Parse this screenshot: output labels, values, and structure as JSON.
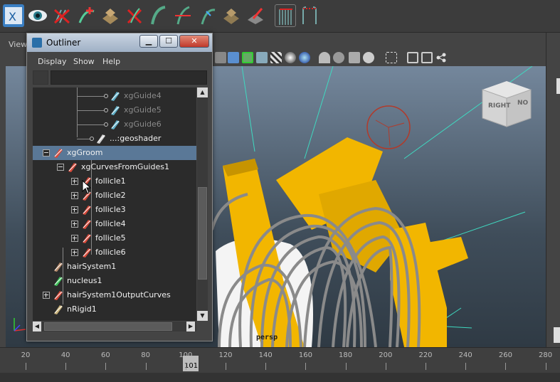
{
  "viewport_menu": {
    "view_label": "View"
  },
  "viewcube": {
    "front": "RIGHT",
    "side": "NO"
  },
  "camera_label": "persp",
  "timeline": {
    "ticks": [
      "20",
      "40",
      "60",
      "80",
      "100",
      "120",
      "140",
      "160",
      "180",
      "200",
      "220",
      "240",
      "260",
      "280"
    ],
    "current_frame": "101"
  },
  "outliner": {
    "title": "Outliner",
    "buttons": {
      "minimize": "▁",
      "maximize": "☐",
      "close": "✕"
    },
    "menu": [
      "Display",
      "Show",
      "Help"
    ],
    "search": {
      "value": ""
    },
    "rows": [
      {
        "label": "xgGuide4",
        "dim": true,
        "icon": "xgen-guide-icon"
      },
      {
        "label": "xgGuide5",
        "dim": true,
        "icon": "xgen-guide-icon"
      },
      {
        "label": "xgGuide6",
        "dim": true,
        "icon": "xgen-guide-icon"
      },
      {
        "label": "...:geoshader",
        "dim": false,
        "icon": "geoshader-icon"
      },
      {
        "label": "xgGroom",
        "dim": false,
        "icon": "groom-icon",
        "selected": true
      },
      {
        "label": "xgCurvesFromGuides1",
        "dim": false,
        "icon": "curves-icon"
      },
      {
        "label": "follicle1",
        "dim": false,
        "icon": "follicle-icon"
      },
      {
        "label": "follicle2",
        "dim": false,
        "icon": "follicle-icon"
      },
      {
        "label": "follicle3",
        "dim": false,
        "icon": "follicle-icon"
      },
      {
        "label": "follicle4",
        "dim": false,
        "icon": "follicle-icon"
      },
      {
        "label": "follicle5",
        "dim": false,
        "icon": "follicle-icon"
      },
      {
        "label": "follicle6",
        "dim": false,
        "icon": "follicle-icon"
      },
      {
        "label": "hairSystem1",
        "dim": false,
        "icon": "hair-system-icon"
      },
      {
        "label": "nucleus1",
        "dim": false,
        "icon": "nucleus-icon"
      },
      {
        "label": "hairSystem1OutputCurves",
        "dim": false,
        "icon": "output-curves-icon"
      },
      {
        "label": "nRigid1",
        "dim": false,
        "icon": "nrigid-icon"
      }
    ]
  },
  "colors": {
    "yellow_geo": "#f2b600",
    "hair_grey": "#8a8a8a",
    "selection": "#5a7897",
    "viewport_top": "#74879c"
  }
}
